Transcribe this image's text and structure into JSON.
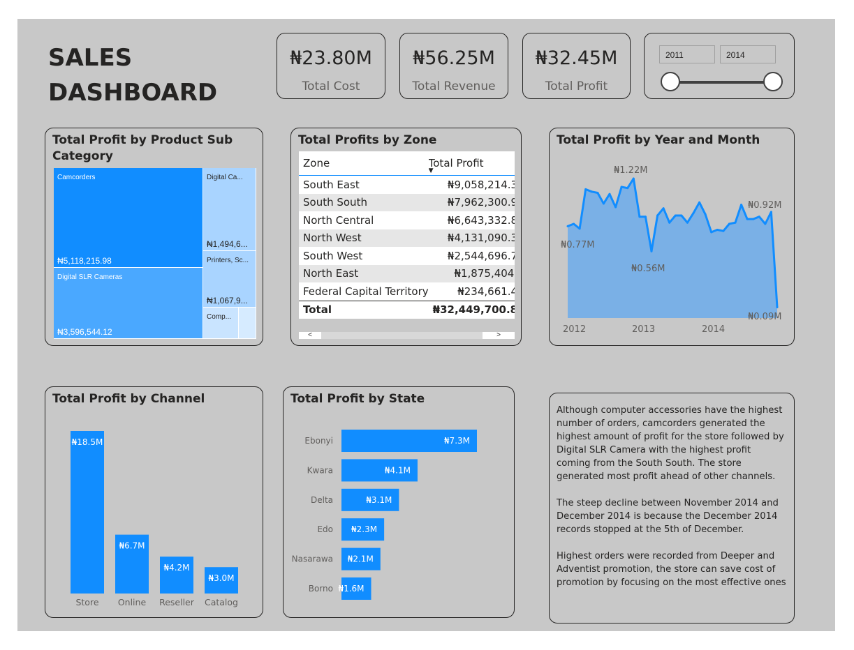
{
  "dashboard": {
    "title_line1": "SALES",
    "title_line2": "DASHBOARD"
  },
  "kpis": [
    {
      "value": "₦23.80M",
      "label": "Total Cost"
    },
    {
      "value": "₦56.25M",
      "label": "Total Revenue"
    },
    {
      "value": "₦32.45M",
      "label": "Total Profit"
    }
  ],
  "year_slicer": {
    "start": "2011",
    "end": "2014"
  },
  "treemap": {
    "title": "Total Profit by Product Sub Category",
    "tiles": [
      {
        "name": "Camcorders",
        "value": "₦5,118,215.98"
      },
      {
        "name": "Digital SLR Cameras",
        "value": "₦3,596,544.12"
      },
      {
        "name": "Digital Ca...",
        "value": "₦1,494,6..."
      },
      {
        "name": "Printers, Sc...",
        "value": "₦1,067,9..."
      },
      {
        "name": "Comp...",
        "value": ""
      }
    ]
  },
  "zone_table": {
    "title": "Total Profits by Zone",
    "col_zone": "Zone",
    "col_profit": "Total Profit",
    "rows": [
      {
        "zone": "South East",
        "profit": "₦9,058,214.3"
      },
      {
        "zone": "South South",
        "profit": "₦7,962,300.9"
      },
      {
        "zone": "North Central",
        "profit": "₦6,643,332.8"
      },
      {
        "zone": "North West",
        "profit": "₦4,131,090.3"
      },
      {
        "zone": "South West",
        "profit": "₦2,544,696.7"
      },
      {
        "zone": "North East",
        "profit": "₦1,875,404."
      },
      {
        "zone": "Federal Capital Territory",
        "profit": "₦234,661.4"
      }
    ],
    "total_label": "Total",
    "total_value": "₦32,449,700.8",
    "scroll_left": "<",
    "scroll_right": ">"
  },
  "line_chart": {
    "title": "Total Profit by Year and Month",
    "color": "#118dff",
    "fill": "#7ab0e6",
    "x_ticks": [
      "2012",
      "2013",
      "2014"
    ],
    "annotations": {
      "max": "₦1.22M",
      "start": "₦0.77M",
      "min_mid": "₦0.56M",
      "right": "₦0.92M",
      "end": "₦0.09M"
    }
  },
  "channel_chart": {
    "title": "Total Profit by Channel",
    "color": "#118dff",
    "bars": [
      {
        "label": "Store",
        "value": 18.5,
        "text": "₦18.5M"
      },
      {
        "label": "Online",
        "value": 6.7,
        "text": "₦6.7M"
      },
      {
        "label": "Reseller",
        "value": 4.2,
        "text": "₦4.2M"
      },
      {
        "label": "Catalog",
        "value": 3.0,
        "text": "₦3.0M"
      }
    ]
  },
  "state_chart": {
    "title": "Total Profit by State",
    "color": "#118dff",
    "bars": [
      {
        "label": "Ebonyi",
        "value": 7.3,
        "text": "₦7.3M"
      },
      {
        "label": "Kwara",
        "value": 4.1,
        "text": "₦4.1M"
      },
      {
        "label": "Delta",
        "value": 3.1,
        "text": "₦3.1M"
      },
      {
        "label": "Edo",
        "value": 2.3,
        "text": "₦2.3M"
      },
      {
        "label": "Nasarawa",
        "value": 2.1,
        "text": "₦2.1M"
      },
      {
        "label": "Borno",
        "value": 1.6,
        "text": "₦1.6M"
      }
    ]
  },
  "insights": {
    "p1": "Although computer accessories have the highest number of orders, camcorders generated the highest amount of profit for the store followed by Digital SLR Camera with the highest profit coming from the South South.  The store generated most profit ahead of other channels.",
    "p2": "The steep decline between November 2014 and December 2014 is because the December 2014 records stopped at the 5th of December.",
    "p3": "Highest orders were recorded from Deeper and Adventist promotion, the store can save cost of promotion by focusing on the most effective ones"
  },
  "chart_data": [
    {
      "type": "area",
      "title": "Total Profit by Year and Month",
      "x": [
        "2012-01",
        "2012-02",
        "2012-03",
        "2012-04",
        "2012-05",
        "2012-06",
        "2012-07",
        "2012-08",
        "2012-09",
        "2012-10",
        "2012-11",
        "2012-12",
        "2013-01",
        "2013-02",
        "2013-03",
        "2013-04",
        "2013-05",
        "2013-06",
        "2013-07",
        "2013-08",
        "2013-09",
        "2013-10",
        "2013-11",
        "2013-12",
        "2014-01",
        "2014-02",
        "2014-03",
        "2014-04",
        "2014-05",
        "2014-06",
        "2014-07",
        "2014-08",
        "2014-09",
        "2014-10",
        "2014-11",
        "2014-12"
      ],
      "values": [
        0.77,
        0.79,
        0.75,
        1.08,
        1.06,
        1.05,
        0.96,
        1.04,
        0.93,
        1.1,
        1.09,
        1.17,
        0.85,
        0.85,
        0.56,
        0.86,
        0.92,
        0.8,
        0.86,
        0.86,
        0.8,
        0.88,
        0.97,
        0.87,
        0.72,
        0.74,
        0.73,
        0.79,
        0.8,
        0.95,
        0.83,
        0.83,
        0.85,
        0.79,
        0.89,
        0.09
      ],
      "x_ticks": [
        "2012",
        "2013",
        "2014"
      ],
      "labels": [
        "₦1.22M",
        "₦0.77M",
        "₦0.56M",
        "₦0.92M",
        "₦0.09M"
      ]
    },
    {
      "type": "bar",
      "title": "Total Profit by Channel",
      "categories": [
        "Store",
        "Online",
        "Reseller",
        "Catalog"
      ],
      "values": [
        18.5,
        6.7,
        4.2,
        3.0
      ]
    },
    {
      "type": "bar",
      "title": "Total Profit by State",
      "categories": [
        "Ebonyi",
        "Kwara",
        "Delta",
        "Edo",
        "Nasarawa",
        "Borno"
      ],
      "values": [
        7.3,
        4.1,
        3.1,
        2.3,
        2.1,
        1.6
      ]
    }
  ]
}
